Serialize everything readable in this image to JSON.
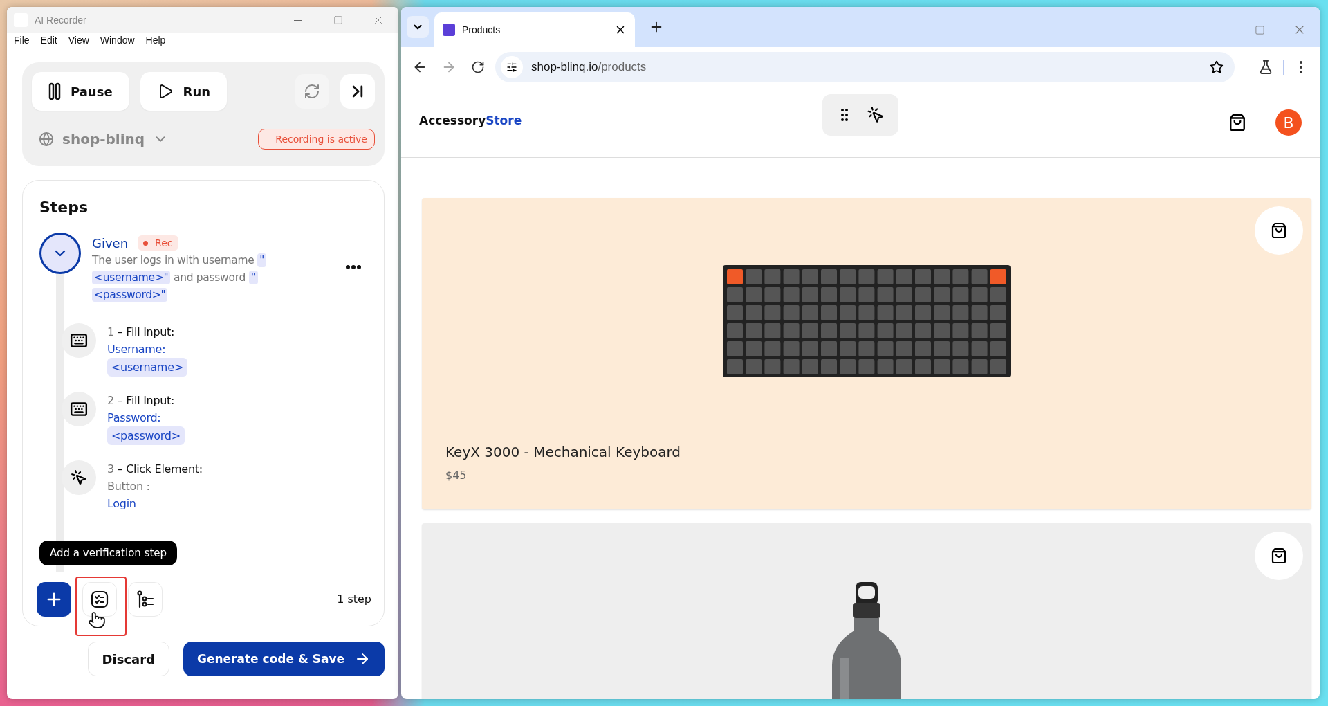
{
  "recorder_window": {
    "title": "AI Recorder",
    "menu": [
      "File",
      "Edit",
      "View",
      "Window",
      "Help"
    ],
    "controls": {
      "pause": "Pause",
      "run": "Run",
      "project": "shop-blinq",
      "status": "Recording is active"
    },
    "steps_panel": {
      "title": "Steps",
      "group": {
        "keyword": "Given",
        "badge": "Rec",
        "expanded": true,
        "description": [
          {
            "kind": "plain",
            "text": "The user logs in with username"
          },
          {
            "kind": "param",
            "text": "\"<username>\""
          },
          {
            "kind": "plain",
            "text": "and password"
          },
          {
            "kind": "param",
            "text": "\"<password>\""
          }
        ]
      },
      "steps": [
        {
          "kind": "input",
          "number": "1",
          "action": "– Fill Input:",
          "target": "Username:",
          "value": "<username>"
        },
        {
          "kind": "input",
          "number": "2",
          "action": "– Fill Input:",
          "target": "Password:",
          "value": "<password>"
        },
        {
          "kind": "click",
          "number": "3",
          "action": "– Click Element:",
          "element_type": "Button :",
          "target": "Login"
        }
      ],
      "tooltip": "Add a verification step",
      "step_count": "1 step"
    },
    "footer": {
      "discard": "Discard",
      "save": "Generate code & Save"
    }
  },
  "browser_window": {
    "tab": {
      "title": "Products"
    },
    "url_host": "shop-blinq.io",
    "url_path": "/products",
    "site": {
      "brand": [
        "Accessory",
        "Store"
      ],
      "avatar": "B",
      "products": [
        {
          "kind": "keyboard",
          "color": "#fdebd7",
          "name": "KeyX 3000 - Mechanical Keyboard",
          "price": "$45"
        },
        {
          "kind": "bottle",
          "color": "#eeeeee"
        }
      ]
    }
  }
}
